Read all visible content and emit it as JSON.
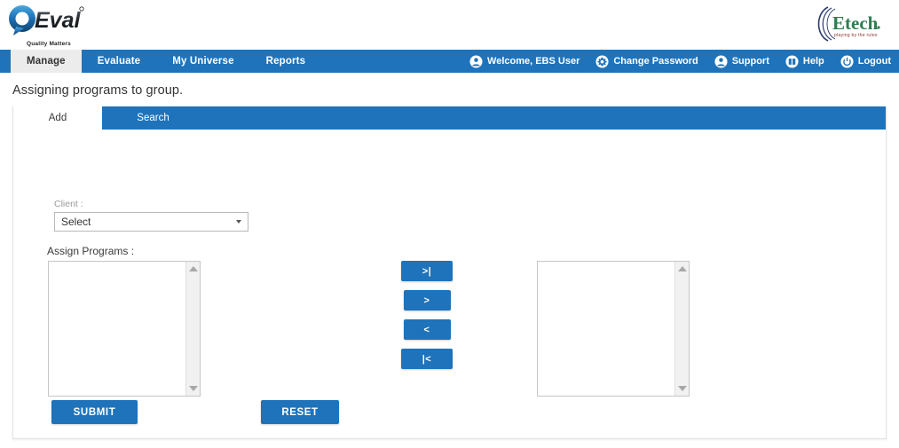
{
  "header": {
    "brand_logo": {
      "name": "QEval",
      "tagline": "Quality Matters"
    },
    "partner_logo": {
      "name": "Etech",
      "tagline": "playing by the rules"
    }
  },
  "navbar": {
    "items": [
      {
        "label": "Manage",
        "active": true
      },
      {
        "label": "Evaluate",
        "active": false
      },
      {
        "label": "My Universe",
        "active": false
      },
      {
        "label": "Reports",
        "active": false
      }
    ],
    "utilities": [
      {
        "label": "Welcome, EBS User",
        "icon": "user-icon"
      },
      {
        "label": "Change Password",
        "icon": "gear-icon"
      },
      {
        "label": "Support",
        "icon": "user-icon"
      },
      {
        "label": "Help",
        "icon": "book-icon"
      },
      {
        "label": "Logout",
        "icon": "power-icon"
      }
    ]
  },
  "page": {
    "title": "Assigning programs to group."
  },
  "card": {
    "tabs": [
      {
        "label": "Add",
        "active": true
      },
      {
        "label": "Search",
        "active": false
      }
    ],
    "client_field": {
      "label": "Client :",
      "value": "Select",
      "options": [
        "Select"
      ]
    },
    "assign_programs": {
      "label": "Assign Programs :",
      "available_items": [],
      "selected_items": []
    },
    "transfer_buttons": [
      {
        "label": ">|",
        "name": "move-all-right-button"
      },
      {
        "label": ">",
        "name": "move-right-button"
      },
      {
        "label": "<",
        "name": "move-left-button"
      },
      {
        "label": "|<",
        "name": "move-all-left-button"
      }
    ],
    "actions": {
      "submit_label": "SUBMIT",
      "reset_label": "RESET"
    }
  },
  "colors": {
    "brand_blue": "#1f73ba",
    "active_tab_bg": "#ececec",
    "etech_green": "#2e7d4f",
    "etech_navy": "#2b3a6b"
  }
}
